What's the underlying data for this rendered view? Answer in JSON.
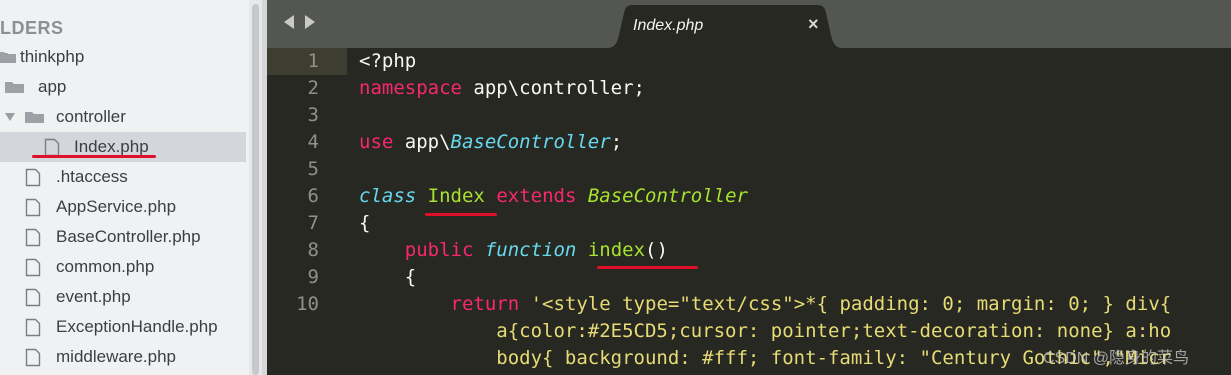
{
  "sidebar": {
    "header": "LDERS",
    "items": [
      {
        "label": "thinkphp",
        "kind": "folder",
        "icon": "folder-open-icon"
      },
      {
        "label": "app",
        "kind": "folder",
        "icon": "folder-open-icon"
      },
      {
        "label": "controller",
        "kind": "folder",
        "icon": "folder-open-icon"
      },
      {
        "label": "Index.php",
        "kind": "file",
        "icon": "file-icon",
        "selected": true
      },
      {
        "label": ".htaccess",
        "kind": "file",
        "icon": "file-icon"
      },
      {
        "label": "AppService.php",
        "kind": "file",
        "icon": "file-icon"
      },
      {
        "label": "BaseController.php",
        "kind": "file",
        "icon": "file-icon"
      },
      {
        "label": "common.php",
        "kind": "file",
        "icon": "file-icon"
      },
      {
        "label": "event.php",
        "kind": "file",
        "icon": "file-icon"
      },
      {
        "label": "ExceptionHandle.php",
        "kind": "file",
        "icon": "file-icon"
      },
      {
        "label": "middleware.php",
        "kind": "file",
        "icon": "file-icon"
      }
    ]
  },
  "tabbar": {
    "back_icon": "chevron-left-icon",
    "forward_icon": "chevron-right-icon",
    "tab_title": "Index.php",
    "close_label": "×"
  },
  "editor": {
    "line_numbers": [
      "1",
      "2",
      "3",
      "4",
      "5",
      "6",
      "7",
      "8",
      "9",
      "10"
    ],
    "lines": [
      {
        "t1": "<?php"
      },
      {
        "t1": "namespace",
        "t2": " app\\controller;"
      },
      {
        "t1": ""
      },
      {
        "t1": "use",
        "t2": " app\\",
        "t3": "BaseController",
        "t4": ";"
      },
      {
        "t1": ""
      },
      {
        "t1": "class",
        "t2": " ",
        "t3": "Index",
        "t4": " ",
        "t5": "extends",
        "t6": " ",
        "t7": "BaseController"
      },
      {
        "t1": "{"
      },
      {
        "t1": "    ",
        "t2": "public",
        "t3": " ",
        "t4": "function",
        "t5": " ",
        "t6": "index",
        "t7": "()"
      },
      {
        "t1": "    {"
      },
      {
        "t1": "        ",
        "t2": "return",
        "t3": " ",
        "t4": "'<style type=\"text/css\">*{ padding: 0; margin: 0; } div{"
      },
      {
        "t1": "            a{color:#2E5CD5;cursor: pointer;text-decoration: none} a:ho"
      },
      {
        "t1": "            body{ background: #fff; font-family: \"Century Gothic\",\"Micr"
      }
    ]
  },
  "watermark": "CSDN @隐身的菜鸟",
  "colors": {
    "keyword": "#f92672",
    "type": "#66d9ef",
    "class": "#a6e22e",
    "string": "#e6db74",
    "annotation": "#e0102a"
  }
}
